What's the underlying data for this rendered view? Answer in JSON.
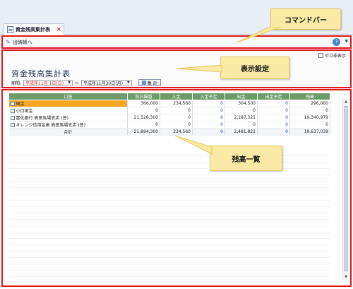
{
  "tab": {
    "title": "資金残高集計表",
    "close": "×"
  },
  "command_bar": {
    "label": "出納帳へ",
    "edit_icon": "pencil-icon",
    "help_icon": "help-icon"
  },
  "settings": {
    "hide_zero_label": "ゼロ非表示",
    "report_title": "資金残高集計表",
    "period_label": "期間:",
    "from_era": "平成",
    "from_date": "年11月 1日(日)",
    "separator": "〜",
    "to_era": "平成",
    "to_date": "年11月30日(月)",
    "calc_button": "集 計"
  },
  "grid": {
    "columns": [
      "口座",
      "前日繰越",
      "入金",
      "入金予定",
      "出金",
      "出金予定",
      "残高"
    ],
    "rows": [
      {
        "account": "現金",
        "carry": "366,000",
        "deposit": "234,560",
        "deposit_plan": "0",
        "withdraw": "304,500",
        "withdraw_plan": "0",
        "balance": "296,060"
      },
      {
        "account": "小口現金",
        "carry": "0",
        "deposit": "0",
        "deposit_plan": "0",
        "withdraw": "0",
        "withdraw_plan": "0",
        "balance": "0"
      },
      {
        "account": "富化銀行 高田馬場支店 (普)",
        "carry": "21,528,300",
        "deposit": "0",
        "deposit_plan": "0",
        "withdraw": "2,187,321",
        "withdraw_plan": "0",
        "balance": "19,340,979"
      },
      {
        "account": "オレンジ信用金庫 高田馬場支店 (普)",
        "carry": "0",
        "deposit": "0",
        "deposit_plan": "0",
        "withdraw": "0",
        "withdraw_plan": "0",
        "balance": "0"
      }
    ],
    "total": {
      "label": "合計",
      "carry": "21,894,300",
      "deposit": "234,560",
      "deposit_plan": "0",
      "withdraw": "2,491,821",
      "withdraw_plan": "0",
      "balance": "19,637,039"
    }
  },
  "callouts": {
    "command_bar": "コマンドバー",
    "settings": "表示設定",
    "list": "残高一覧"
  },
  "colors": {
    "highlight_border": "#e0171f",
    "header_green": "#6e9b6a",
    "selected_row": "#f6a623",
    "callout_fill": "#fbe9a6"
  }
}
